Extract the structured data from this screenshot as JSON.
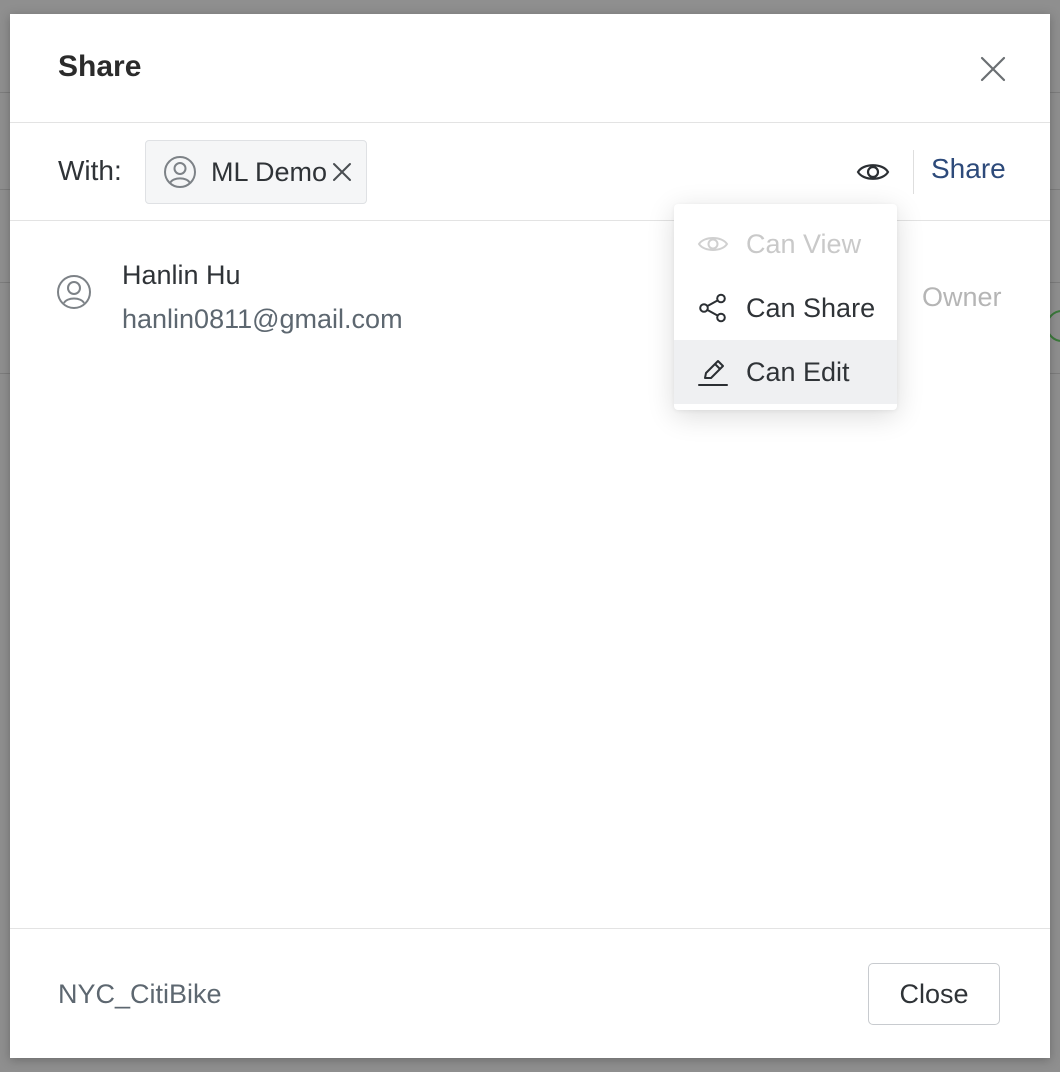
{
  "dialog": {
    "title": "Share",
    "close_icon": "close-icon"
  },
  "share_with": {
    "label": "With:",
    "chips": [
      {
        "label": "ML Demo",
        "icon": "user-circle-icon",
        "remove_icon": "remove-icon"
      }
    ],
    "permission_icon": "eye-icon",
    "share_label": "Share"
  },
  "permission_menu": {
    "items": [
      {
        "label": "Can View",
        "icon": "eye-icon",
        "disabled": true
      },
      {
        "label": "Can Share",
        "icon": "share-icon",
        "disabled": false
      },
      {
        "label": "Can Edit",
        "icon": "pencil-icon",
        "disabled": false,
        "highlighted": true
      }
    ]
  },
  "members": [
    {
      "name": "Hanlin Hu",
      "email": "hanlin0811@gmail.com",
      "role": "Owner",
      "icon": "user-circle-icon"
    }
  ],
  "footer": {
    "dataset_name": "NYC_CitiBike",
    "close_label": "Close"
  },
  "colors": {
    "share_link": "#2d4a7a",
    "text_primary": "#2f3337",
    "text_secondary": "#5d6770",
    "disabled": "#c9c9c9",
    "highlight_bg": "#eff0f2"
  }
}
